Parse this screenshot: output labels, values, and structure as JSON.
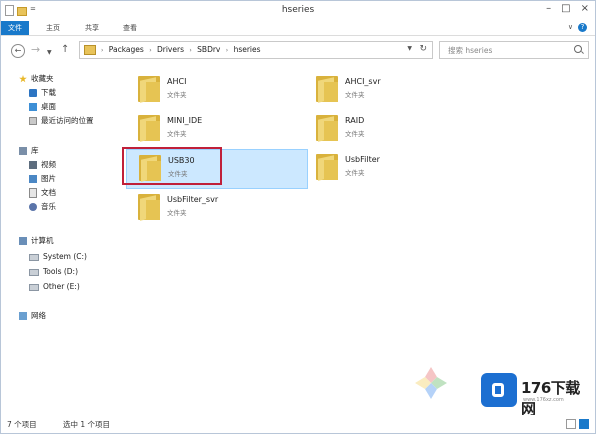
{
  "window": {
    "title": "hseries"
  },
  "ribbon": {
    "tabs": [
      "文件",
      "主页",
      "共享",
      "查看"
    ],
    "help": "?"
  },
  "address": {
    "crumbs": [
      "Packages",
      "Drivers",
      "SBDrv",
      "hseries"
    ],
    "search_placeholder": "搜索 hseries"
  },
  "nav": {
    "favorites": "收藏夹",
    "download": "下载",
    "desktop": "桌面",
    "recent": "最近访问的位置",
    "libraries": "库",
    "videos": "视频",
    "pictures": "图片",
    "documents": "文档",
    "music": "音乐",
    "computer": "计算机",
    "drive_c": "System (C:)",
    "drive_d": "Tools (D:)",
    "drive_e": "Other (E:)",
    "network": "网络"
  },
  "items": [
    {
      "name": "AHCI",
      "type": "文件夹"
    },
    {
      "name": "AHCI_svr",
      "type": "文件夹"
    },
    {
      "name": "MINI_IDE",
      "type": "文件夹"
    },
    {
      "name": "RAID",
      "type": "文件夹"
    },
    {
      "name": "USB30",
      "type": "文件夹",
      "selected": true
    },
    {
      "name": "UsbFilter",
      "type": "文件夹"
    },
    {
      "name": "UsbFilter_svr",
      "type": "文件夹"
    }
  ],
  "status": {
    "count": "7 个项目",
    "selected": "选中 1 个项目"
  },
  "watermark": {
    "brand": "176下载网",
    "url": "www.176xz.com"
  },
  "colors": {
    "accent": "#1979ca",
    "selection": "#cce8ff",
    "highlight_border": "#c0203a"
  }
}
